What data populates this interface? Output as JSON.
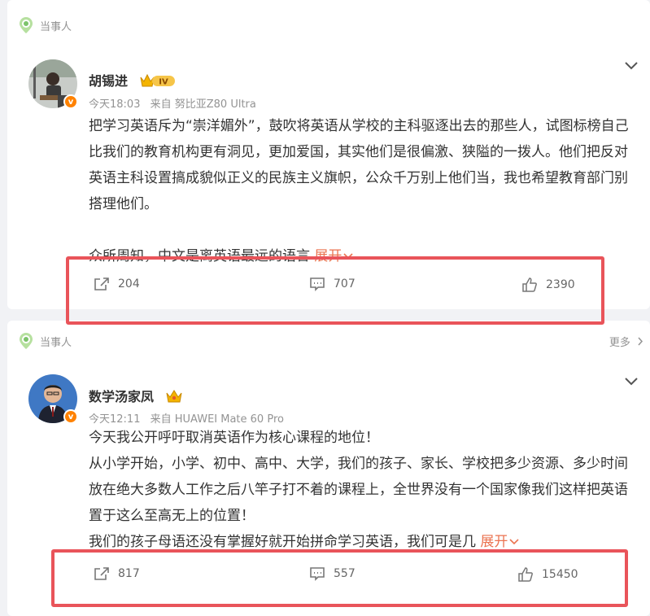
{
  "colors": {
    "accent": "#eb7350",
    "highlight_box": "#e9545a",
    "tag_icon": "#7cc36b",
    "verified": "#ff8200"
  },
  "posts": [
    {
      "tag_label": "当事人",
      "author": "胡锡进",
      "author_badge": "IV",
      "time": "今天18:03",
      "source": "来自 努比亚Z80 Ultra",
      "paragraphs": [
        "把学习英语斥为“崇洋媚外”，鼓吹将英语从学校的主科驱逐出去的那些人，试图标榜自己比我们的教育机构更有洞见，更加爱国，其实他们是很偏激、狭隘的一拨人。他们把反对英语主科设置搞成貌似正义的民族主义旗帜，公众千万别上他们当，我也希望教育部门别搭理他们。",
        "众所周知，中文是离英语最远的语言"
      ],
      "expand_label": "展开",
      "reposts": "204",
      "comments": "707",
      "likes": "2390"
    },
    {
      "tag_label": "当事人",
      "more_label": "更多",
      "author": "数学汤家凤",
      "time": "今天12:11",
      "source": "来自 HUAWEI Mate 60 Pro",
      "paragraphs": [
        "今天我公开呼吁取消英语作为核心课程的地位！",
        "从小学开始，小学、初中、高中、大学，我们的孩子、家长、学校把多少资源、多少时间放在绝大多数人工作之后八竿子打不着的课程上，全世界没有一个国家像我们这样把英语置于这么至高无上的位置！",
        "我们的孩子母语还没有掌握好就开始拼命学习英语，我们可是几"
      ],
      "expand_label": "展开",
      "reposts": "817",
      "comments": "557",
      "likes": "15450"
    }
  ]
}
